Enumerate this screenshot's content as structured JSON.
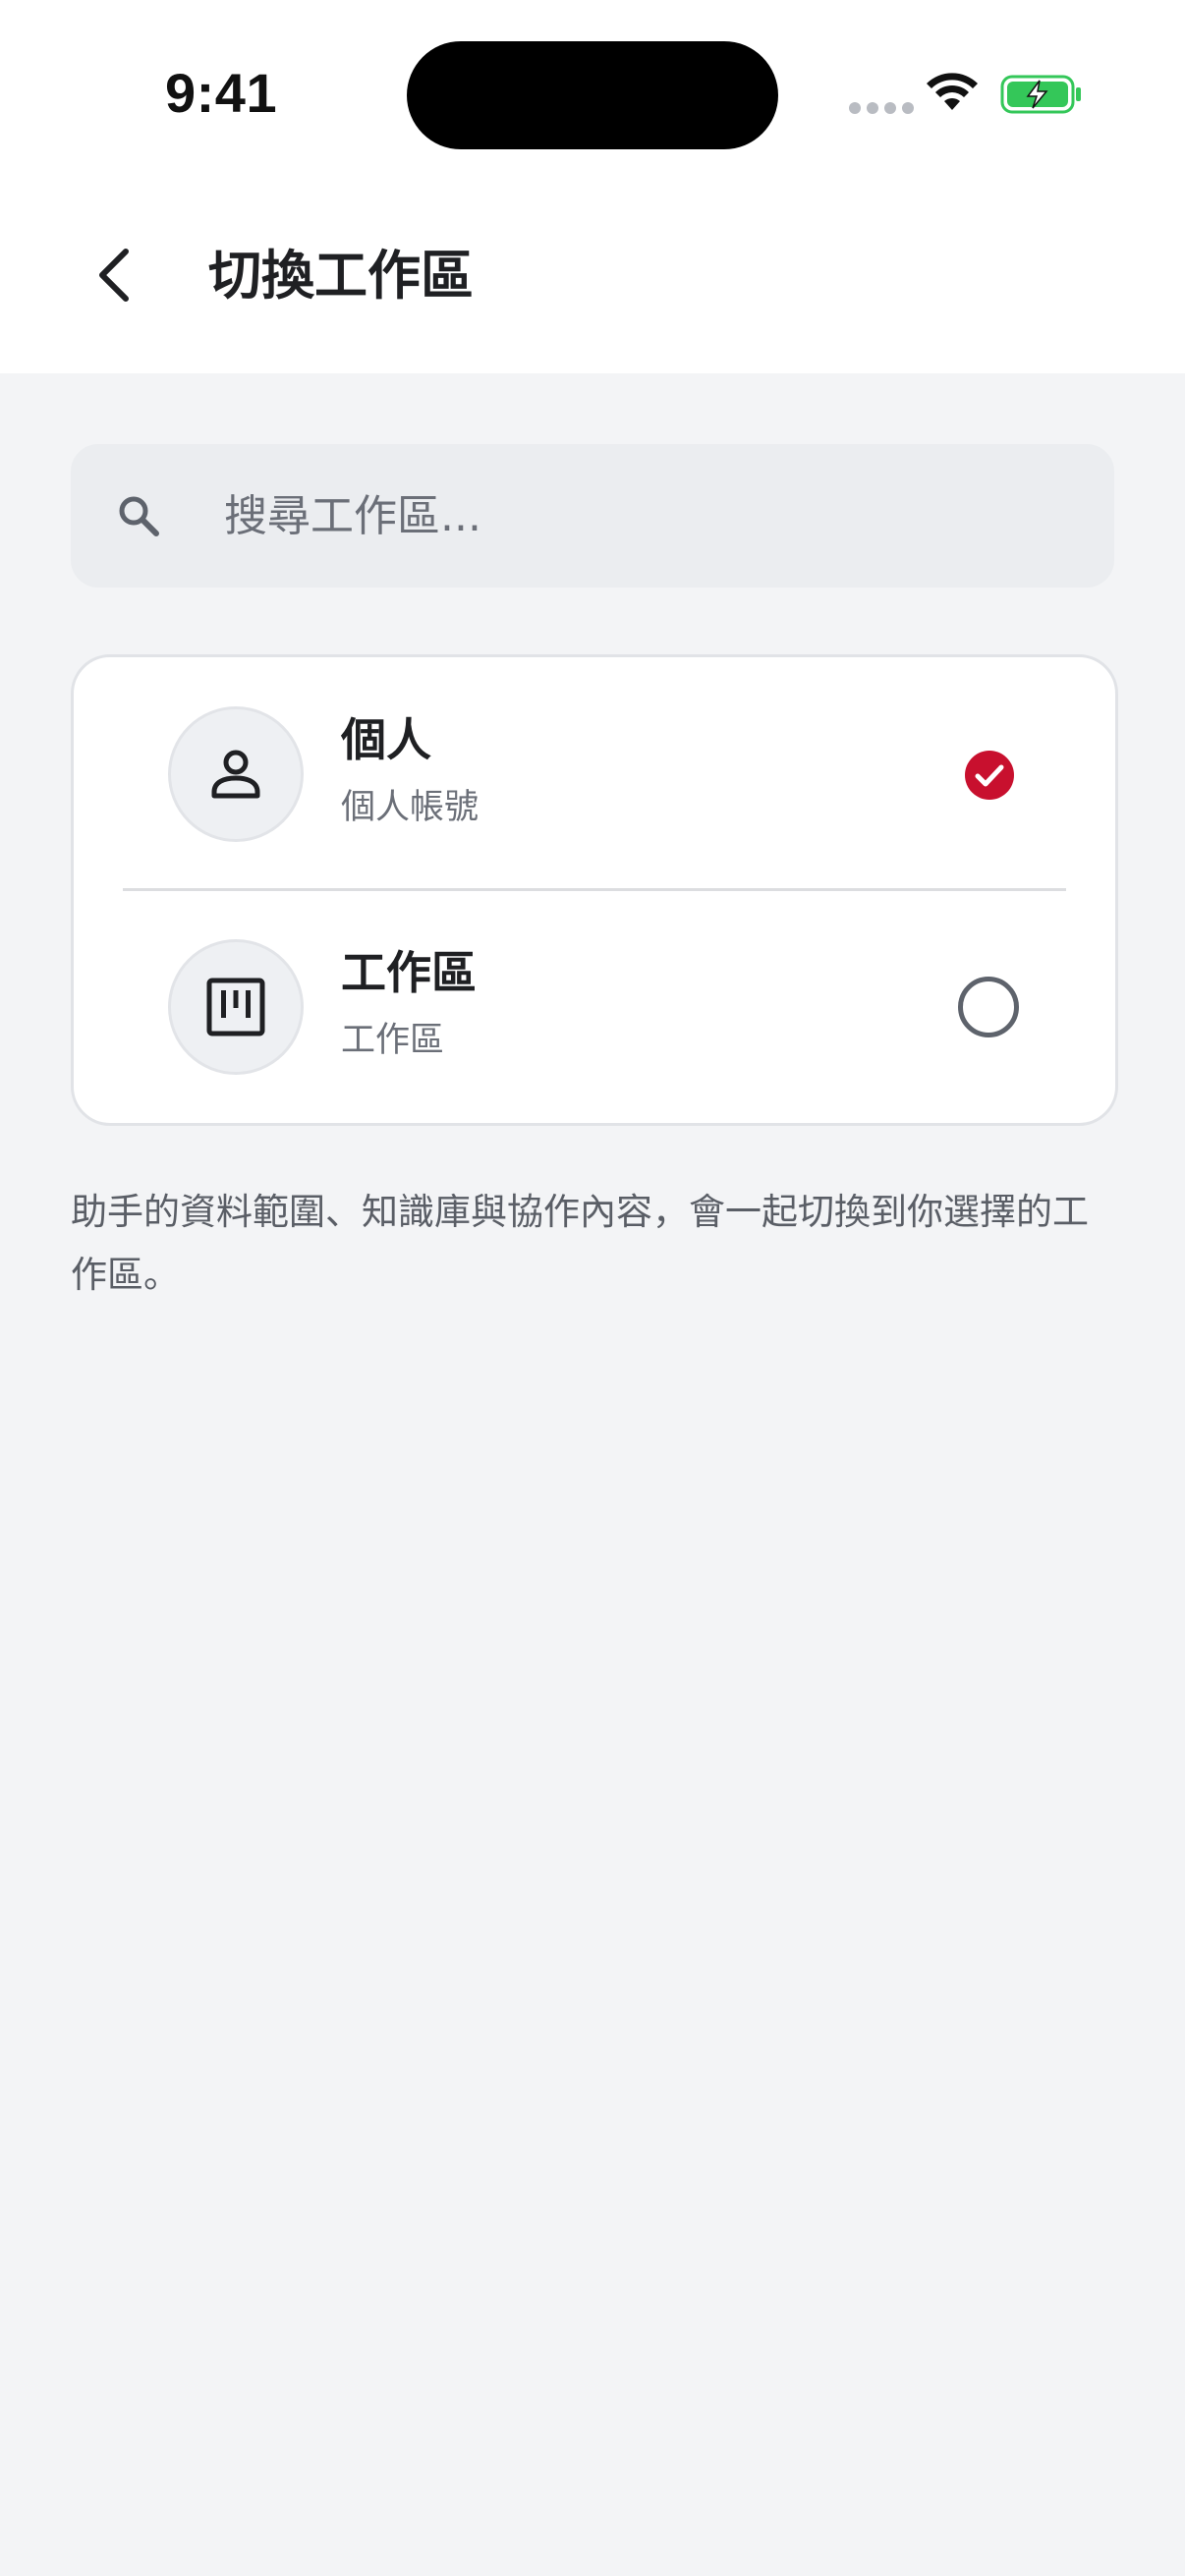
{
  "status_bar": {
    "time": "9:41",
    "icons": [
      "cellular-signal-icon",
      "wifi-icon",
      "battery-charging-icon"
    ],
    "battery_color": "#34c759"
  },
  "header": {
    "title": "切換工作區",
    "back_icon": "chevron-left-icon"
  },
  "search": {
    "placeholder": "搜尋工作區...",
    "value": "",
    "icon": "search-icon"
  },
  "workspaces": [
    {
      "name": "個人",
      "subtitle": "個人帳號",
      "icon": "person-icon",
      "selected": true
    },
    {
      "name": "工作區",
      "subtitle": "工作區",
      "icon": "kanban-board-icon",
      "selected": false
    }
  ],
  "description": "助手的資料範圍、知識庫與協作內容，會一起切換到你選擇的工作區。",
  "colors": {
    "accent": "#c8102e",
    "background": "#f3f4f6",
    "surface": "#ffffff",
    "text_primary": "#1f2023",
    "text_secondary": "#6b6f78"
  }
}
